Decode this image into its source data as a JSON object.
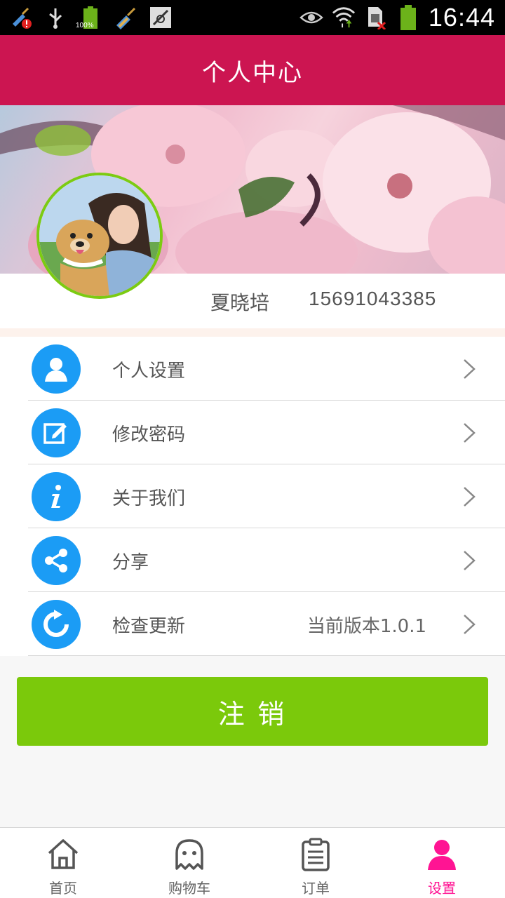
{
  "status_bar": {
    "time": "16:44",
    "battery_label": "100%",
    "icons": [
      "broom-alert-icon",
      "usb-icon",
      "battery-full-icon",
      "broom-icon",
      "no-sim-card-icon",
      "eye-icon",
      "wifi-icon",
      "sim-error-icon",
      "battery-icon"
    ]
  },
  "header": {
    "title": "个人中心"
  },
  "profile": {
    "name": "夏晓培",
    "phone": "15691043385"
  },
  "menu": {
    "items": [
      {
        "label": "个人设置",
        "icon": "user-icon",
        "value": ""
      },
      {
        "label": "修改密码",
        "icon": "edit-icon",
        "value": ""
      },
      {
        "label": "关于我们",
        "icon": "info-icon",
        "value": ""
      },
      {
        "label": "分享",
        "icon": "share-icon",
        "value": ""
      },
      {
        "label": "检查更新",
        "icon": "refresh-icon",
        "value": "当前版本1.0.1"
      }
    ]
  },
  "logout_label": "注 销",
  "bottom_nav": {
    "items": [
      {
        "label": "首页",
        "icon": "home-icon",
        "active": false
      },
      {
        "label": "购物车",
        "icon": "ghost-icon",
        "active": false
      },
      {
        "label": "订单",
        "icon": "order-list-icon",
        "active": false
      },
      {
        "label": "设置",
        "icon": "person-icon",
        "active": true
      }
    ]
  },
  "colors": {
    "header": "#cc1551",
    "menu_icon_bg": "#1b9cf5",
    "logout": "#7bc90b",
    "avatar_border": "#7ccb12",
    "nav_active": "#ff1493"
  }
}
